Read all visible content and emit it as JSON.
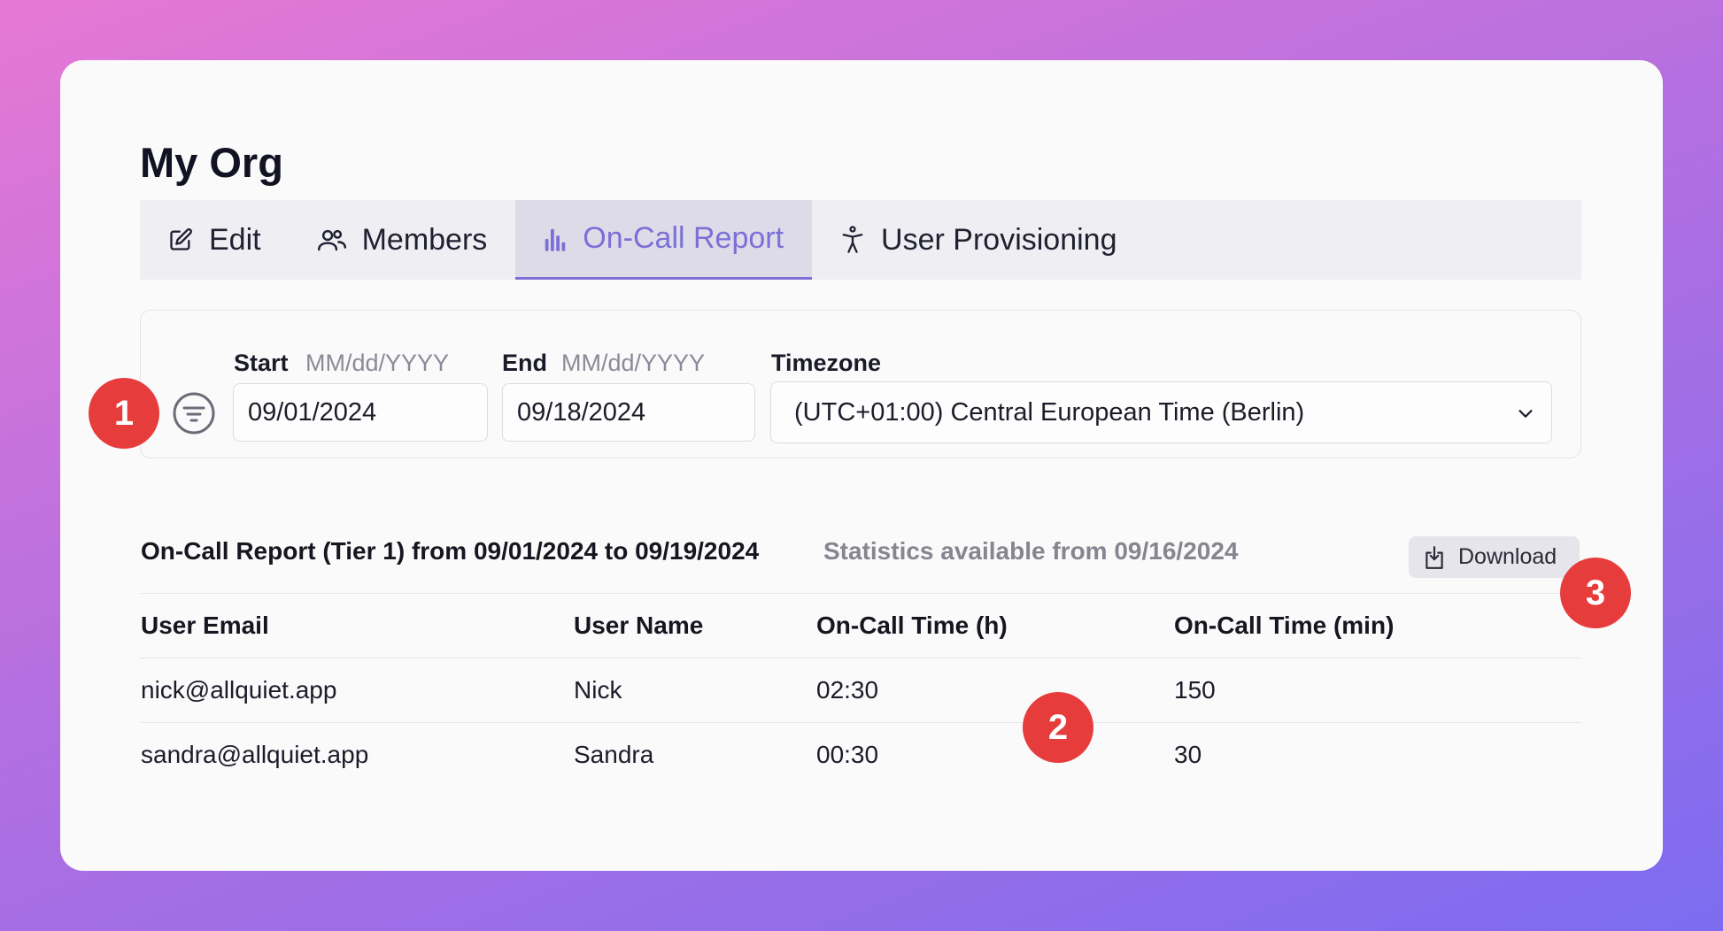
{
  "org": {
    "title": "My Org"
  },
  "tabs": [
    {
      "label": "Edit",
      "icon": "edit-icon",
      "active": false
    },
    {
      "label": "Members",
      "icon": "members-icon",
      "active": false
    },
    {
      "label": "On-Call Report",
      "icon": "bar-chart-icon",
      "active": true
    },
    {
      "label": "User Provisioning",
      "icon": "accessibility-icon",
      "active": false
    }
  ],
  "filters": {
    "start": {
      "label": "Start",
      "format": "MM/dd/YYYY",
      "value": "09/01/2024"
    },
    "end": {
      "label": "End",
      "format": "MM/dd/YYYY",
      "value": "09/18/2024"
    },
    "timezone": {
      "label": "Timezone",
      "value": "(UTC+01:00) Central European Time (Berlin)"
    }
  },
  "report": {
    "title": "On-Call Report (Tier 1) from 09/01/2024 to 09/19/2024",
    "stats": "Statistics available from 09/16/2024",
    "download_label": "Download"
  },
  "table": {
    "columns": [
      "User Email",
      "User Name",
      "On-Call Time (h)",
      "On-Call Time (min)"
    ],
    "rows": [
      [
        "nick@allquiet.app",
        "Nick",
        "02:30",
        "150"
      ],
      [
        "sandra@allquiet.app",
        "Sandra",
        "00:30",
        "30"
      ]
    ]
  },
  "badges": [
    "1",
    "2",
    "3"
  ],
  "colors": {
    "accent": "#7c6fd6",
    "badge": "#e73c3c"
  }
}
